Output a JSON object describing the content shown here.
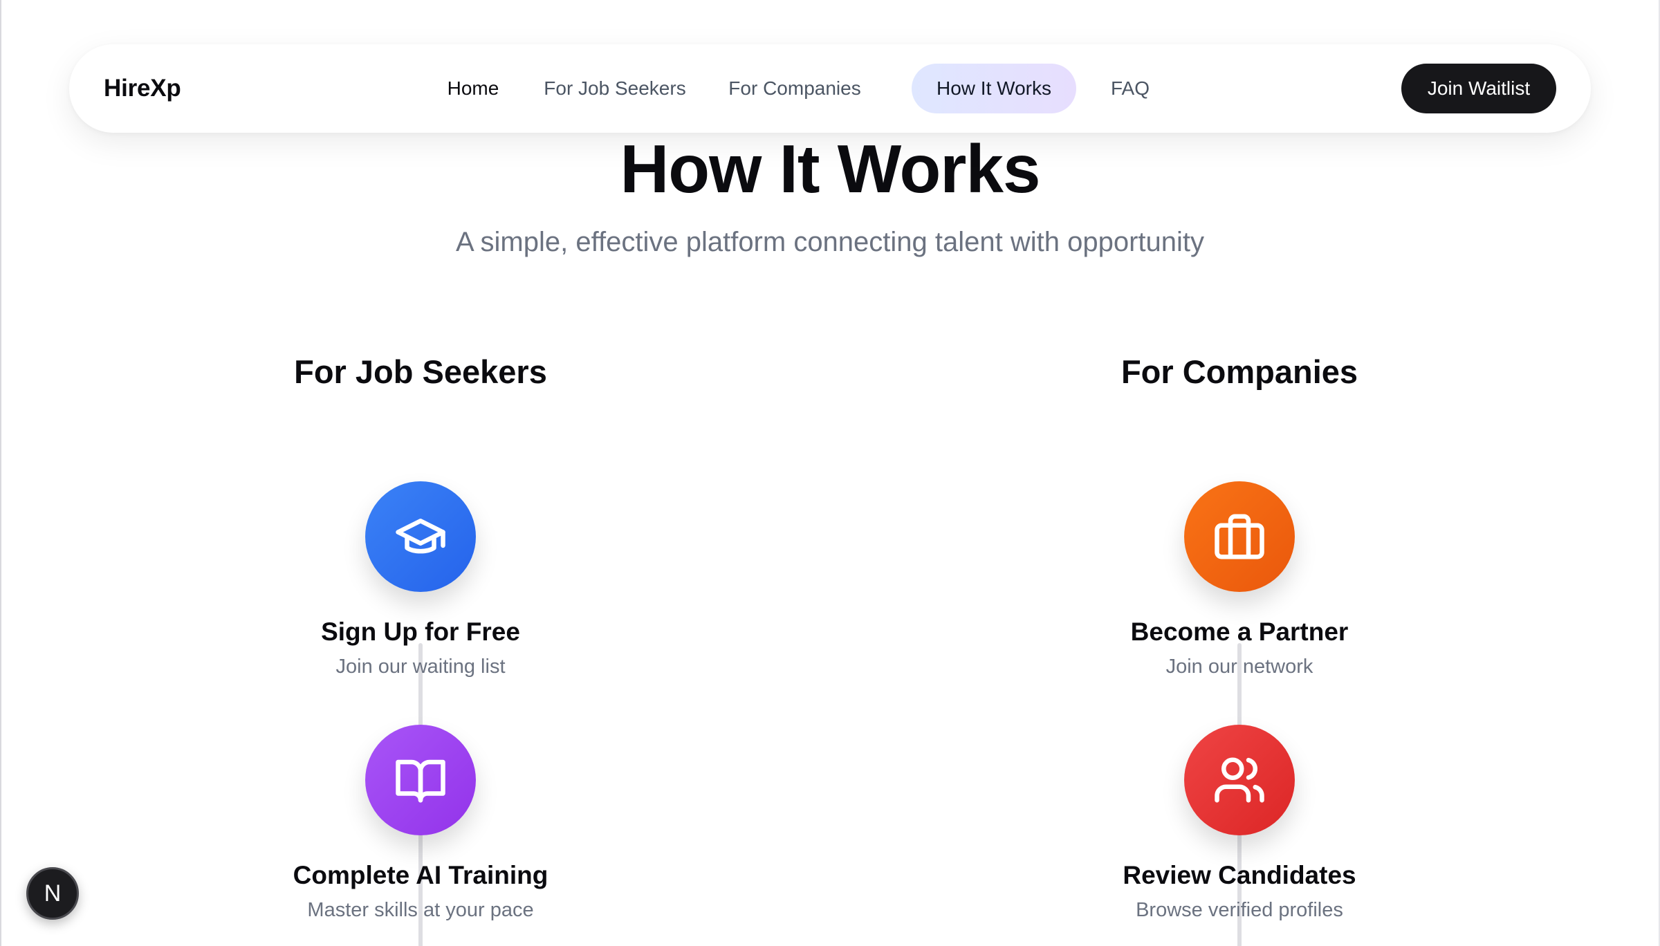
{
  "nav": {
    "brand": "HireXp",
    "links": [
      {
        "label": "Home"
      },
      {
        "label": "For Job Seekers"
      },
      {
        "label": "For Companies"
      },
      {
        "label": "How It Works",
        "active": true
      },
      {
        "label": "FAQ"
      }
    ],
    "cta_label": "Join Waitlist"
  },
  "hero": {
    "title": "How It Works",
    "subtitle": "A simple, effective platform connecting talent with opportunity"
  },
  "columns": [
    {
      "heading": "For Job Seekers",
      "steps": [
        {
          "title": "Sign Up for Free",
          "description": "Join our waiting list",
          "icon": "graduation-cap-icon",
          "color": "#2f6ff0"
        },
        {
          "title": "Complete AI Training",
          "description": "Master skills at your pace",
          "icon": "book-open-icon",
          "color": "#9d44ec"
        }
      ]
    },
    {
      "heading": "For Companies",
      "steps": [
        {
          "title": "Become a Partner",
          "description": "Join our network",
          "icon": "briefcase-icon",
          "color": "#f2680f"
        },
        {
          "title": "Review Candidates",
          "description": "Browse verified profiles",
          "icon": "users-icon",
          "color": "#e32e2e"
        }
      ]
    }
  ],
  "dev_badge": {
    "label": "N"
  },
  "colors": {
    "cta_background": "#17171a",
    "active_nav_background": "#e2e4fe",
    "muted_text": "#6b7280"
  }
}
